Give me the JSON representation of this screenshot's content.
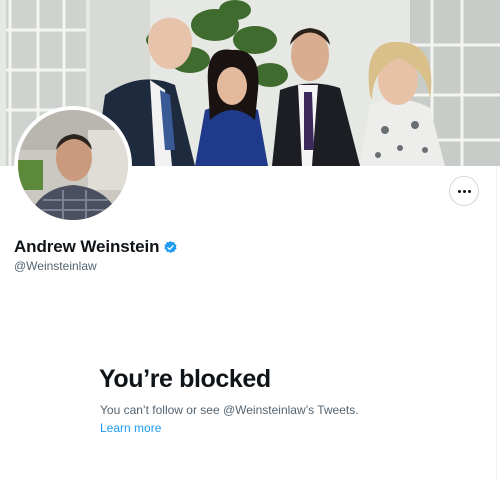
{
  "profile": {
    "display_name": "Andrew Weinstein",
    "handle": "@Weinsteinlaw",
    "verified": true,
    "verified_icon": "verified-badge-icon",
    "more_icon": "more-horizontal-icon"
  },
  "blocked": {
    "title": "You’re blocked",
    "message": "You can’t follow or see @Weinsteinlaw’s Tweets.",
    "link_label": "Learn more"
  },
  "colors": {
    "accent": "#1d9bf0",
    "text_primary": "#0f1419",
    "text_secondary": "#536471",
    "border": "#cfd9de"
  }
}
